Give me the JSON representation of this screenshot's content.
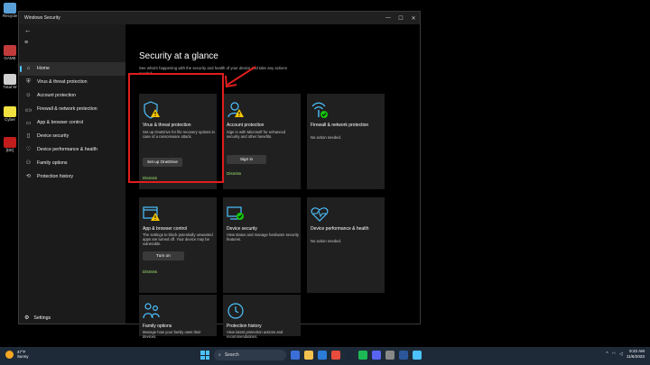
{
  "desktop": {
    "icons": [
      {
        "label": "Recycle",
        "color": "#5aa0d8"
      },
      {
        "label": "GAME",
        "color": "#c23b3b"
      },
      {
        "label": "Total W",
        "color": "#d0d0d0"
      },
      {
        "label": "Cyber",
        "color": "#f0e040"
      },
      {
        "label": "[DE]",
        "color": "#c21c1c"
      }
    ]
  },
  "window": {
    "title": "Windows Security",
    "controls": [
      "—",
      "☐",
      "✕"
    ]
  },
  "sidebar": {
    "back_glyph": "←",
    "menu_glyph": "≡",
    "items": [
      {
        "label": "Home",
        "icon": "⌂",
        "icon_name": "home-icon",
        "active": true
      },
      {
        "label": "Virus & threat protection",
        "icon": "⛨",
        "icon_name": "shield-icon",
        "active": false
      },
      {
        "label": "Account protection",
        "icon": "☺",
        "icon_name": "person-icon",
        "active": false
      },
      {
        "label": "Firewall & network protection",
        "icon": "((·))",
        "icon_name": "wifi-icon",
        "active": false
      },
      {
        "label": "App & browser control",
        "icon": "▭",
        "icon_name": "app-window-icon",
        "active": false
      },
      {
        "label": "Device security",
        "icon": "▯",
        "icon_name": "device-icon",
        "active": false
      },
      {
        "label": "Device performance & health",
        "icon": "♡",
        "icon_name": "heart-icon",
        "active": false
      },
      {
        "label": "Family options",
        "icon": "⚇",
        "icon_name": "family-icon",
        "active": false
      },
      {
        "label": "Protection history",
        "icon": "⟲",
        "icon_name": "history-icon",
        "active": false
      }
    ],
    "settings_label": "Settings",
    "settings_icon": "⚙"
  },
  "main": {
    "title": "Security at a glance",
    "subtitle": "See what's happening with the security and health of your device and take any actions needed.",
    "cards": [
      {
        "title": "Virus & threat protection",
        "desc": "Set up OneDrive for file recovery options in case of a ransomware attack.",
        "button": "Set up OneDrive",
        "dismiss": "Dismiss",
        "icon": "shield-warning-icon"
      },
      {
        "title": "Account protection",
        "desc": "Sign in with Microsoft for enhanced security and other benefits.",
        "button": "Sign in",
        "dismiss": "Dismiss",
        "icon": "person-warning-icon"
      },
      {
        "title": "Firewall & network protection",
        "desc": "No action needed.",
        "button": "",
        "dismiss": "",
        "icon": "wifi-check-icon"
      },
      {
        "title": "App & browser control",
        "desc": "The settings to block potentially unwanted apps are turned off. Your device may be vulnerable.",
        "button": "Turn on",
        "dismiss": "Dismiss",
        "icon": "app-warning-icon"
      },
      {
        "title": "Device security",
        "desc": "View status and manage hardware security features.",
        "button": "",
        "dismiss": "",
        "icon": "device-check-icon"
      },
      {
        "title": "Device performance & health",
        "desc": "No action needed.",
        "button": "",
        "dismiss": "",
        "icon": "heart-pulse-icon"
      },
      {
        "title": "Family options",
        "desc": "Manage how your family uses their devices.",
        "button": "",
        "dismiss": "",
        "icon": "family-icon"
      },
      {
        "title": "Protection history",
        "desc": "View latest protection actions and recommendations.",
        "button": "",
        "dismiss": "",
        "icon": "history-icon"
      }
    ]
  },
  "taskbar": {
    "weather_temp": "47°F",
    "weather_desc": "Sunny",
    "search_placeholder": "Search",
    "time": "9:22 AM",
    "date": "11/6/2023"
  },
  "colors": {
    "accent": "#4cc2ff",
    "warning": "#f7c600",
    "ok": "#16c60c",
    "dismiss": "#9fe870",
    "highlight": "#e01e1e"
  }
}
